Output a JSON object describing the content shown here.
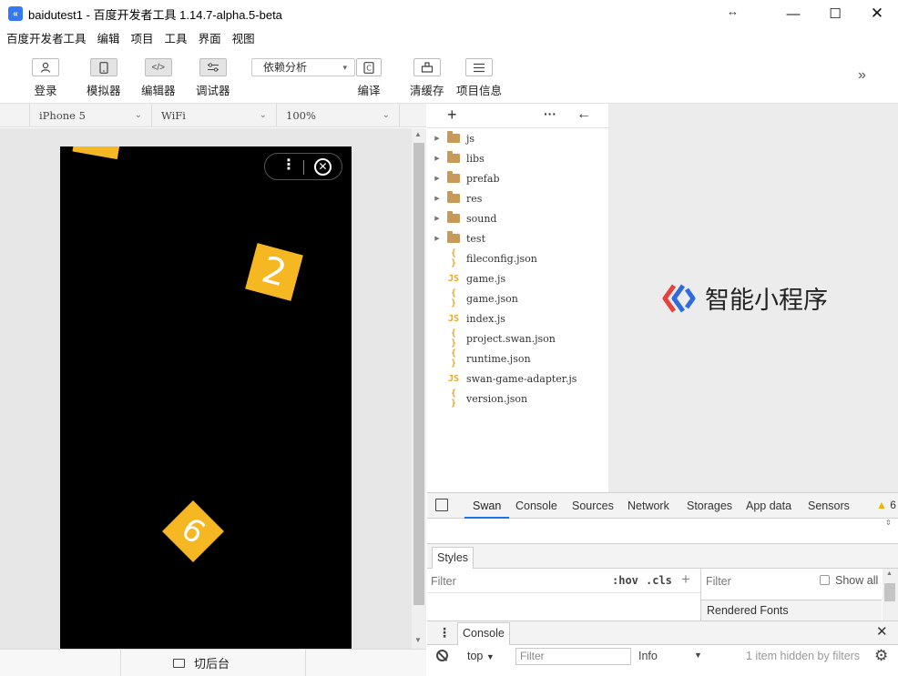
{
  "window": {
    "title": "baidutest1 - 百度开发者工具 1.14.7-alpha.5-beta",
    "app_icon": "swan-logo-icon",
    "controls": [
      "minimize",
      "maximize",
      "close"
    ]
  },
  "menu": [
    "百度开发者工具",
    "编辑",
    "项目",
    "工具",
    "界面",
    "视图"
  ],
  "toolbar": {
    "login": "登录",
    "simulator": "模拟器",
    "editor": "编辑器",
    "debugger": "调试器",
    "dependency_select": "依赖分析",
    "compile": "编译",
    "clear_cache": "清缓存",
    "project_info": "项目信息"
  },
  "simulator": {
    "device": "iPhone 5",
    "network": "WiFi",
    "zoom": "100%",
    "tiles": [
      "2",
      "6"
    ],
    "backstage_label": "切后台"
  },
  "filetree": {
    "items": [
      {
        "name": "js",
        "type": "folder"
      },
      {
        "name": "libs",
        "type": "folder"
      },
      {
        "name": "prefab",
        "type": "folder"
      },
      {
        "name": "res",
        "type": "folder"
      },
      {
        "name": "sound",
        "type": "folder"
      },
      {
        "name": "test",
        "type": "folder"
      },
      {
        "name": "fileconfig.json",
        "type": "json"
      },
      {
        "name": "game.js",
        "type": "js"
      },
      {
        "name": "game.json",
        "type": "json"
      },
      {
        "name": "index.js",
        "type": "js"
      },
      {
        "name": "project.swan.json",
        "type": "json"
      },
      {
        "name": "runtime.json",
        "type": "json"
      },
      {
        "name": "swan-game-adapter.js",
        "type": "js"
      },
      {
        "name": "version.json",
        "type": "json"
      }
    ]
  },
  "preview": {
    "brand_name": "智能小程序"
  },
  "devtools": {
    "tabs": [
      "Swan",
      "Console",
      "Sources",
      "Network",
      "Storages",
      "App data",
      "Sensors"
    ],
    "active_tab": "Swan",
    "warning_count": "6",
    "styles_tab": "Styles",
    "filter_placeholder": "Filter",
    "hov": ":hov",
    "cls": ".cls",
    "right_filter": "Filter",
    "show_all": "Show all",
    "rendered_fonts": "Rendered Fonts",
    "console_tab": "Console",
    "context": "top",
    "console_filter": "Filter",
    "level": "Info",
    "hidden_msg": "1 item hidden by filters"
  },
  "colors": {
    "tile": "#f5b823",
    "accent": "#1a73e8",
    "brand_blue": "#2f6bdc",
    "brand_red": "#e8403a"
  }
}
